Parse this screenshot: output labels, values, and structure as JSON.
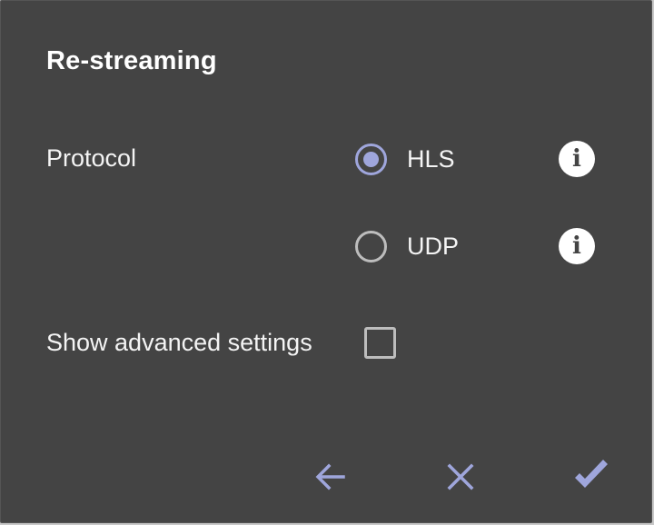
{
  "dialog": {
    "title": "Re-streaming",
    "protocol": {
      "label": "Protocol",
      "options": [
        {
          "label": "HLS",
          "checked": true
        },
        {
          "label": "UDP",
          "checked": false
        }
      ]
    },
    "advanced": {
      "label": "Show advanced settings",
      "checked": false
    }
  },
  "icons": {
    "info_glyph": "i",
    "back": "arrow-left-icon",
    "cancel": "close-icon",
    "confirm": "checkmark-icon"
  },
  "colors": {
    "background": "#444444",
    "accent": "#9fa6dc",
    "text": "#ffffff",
    "control_border": "#bdbdbd"
  }
}
